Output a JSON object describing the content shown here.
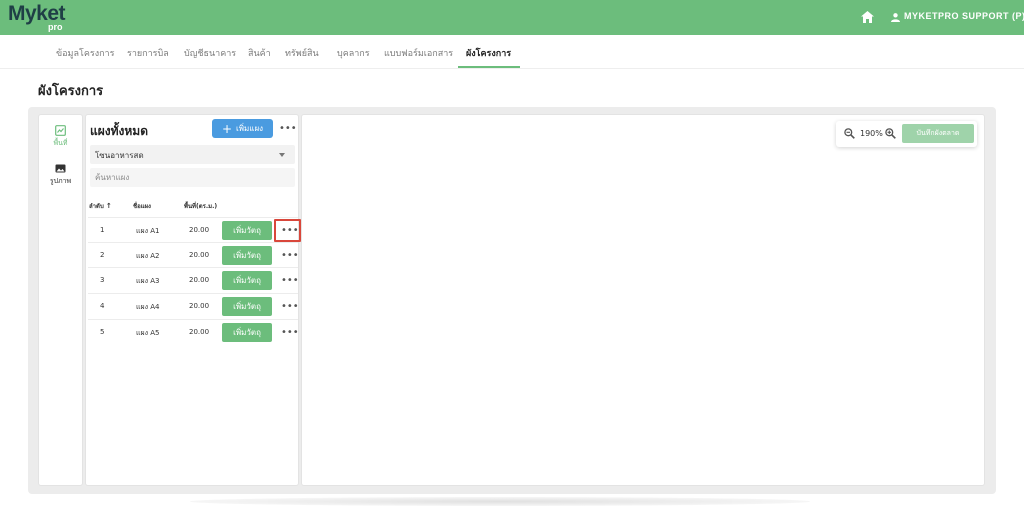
{
  "header": {
    "logo_text": "Myket",
    "logo_sub": "pro",
    "home_icon": "home-icon",
    "user_icon": "user-icon",
    "user_name": "MYKETPRO SUPPORT (P)"
  },
  "tabs": [
    {
      "label": "ข้อมูลโครงการ"
    },
    {
      "label": "รายการบิล"
    },
    {
      "label": "บัญชีธนาคาร"
    },
    {
      "label": "สินค้า"
    },
    {
      "label": "ทรัพย์สิน"
    },
    {
      "label": "บุคลากร"
    },
    {
      "label": "แบบฟอร์มเอกสาร"
    },
    {
      "label": "ผังโครงการ",
      "active": true
    }
  ],
  "page_title": "ผังโครงการ",
  "sidebar": {
    "items": [
      {
        "label": "พื้นที่",
        "icon": "area-icon",
        "active": true
      },
      {
        "label": "รูปภาพ",
        "icon": "image-icon"
      }
    ]
  },
  "list_panel": {
    "title": "แผงทั้งหมด",
    "add_button": "เพิ่มแผง",
    "zone_select": "โซนอาหารสด",
    "search_placeholder": "ค้นหาแผง",
    "columns": [
      "ลำดับ",
      "ชื่อแผง",
      "พื้นที่(ตร.ม.)"
    ],
    "rows": [
      {
        "no": "1",
        "name": "แผง A1",
        "area": "20.00",
        "action": "เพิ่มวัตถุ"
      },
      {
        "no": "2",
        "name": "แผง A2",
        "area": "20.00",
        "action": "เพิ่มวัตถุ"
      },
      {
        "no": "3",
        "name": "แผง A3",
        "area": "20.00",
        "action": "เพิ่มวัตถุ"
      },
      {
        "no": "4",
        "name": "แผง A4",
        "area": "20.00",
        "action": "เพิ่มวัตถุ"
      },
      {
        "no": "5",
        "name": "แผง A5",
        "area": "20.00",
        "action": "เพิ่มวัตถุ"
      }
    ]
  },
  "canvas": {
    "zoom_level": "190%",
    "save_button": "บันทึกผังตลาด"
  },
  "colors": {
    "brand_green": "#6cbd7c",
    "primary_blue": "#4a9be0",
    "highlight_red": "#d9473b"
  }
}
